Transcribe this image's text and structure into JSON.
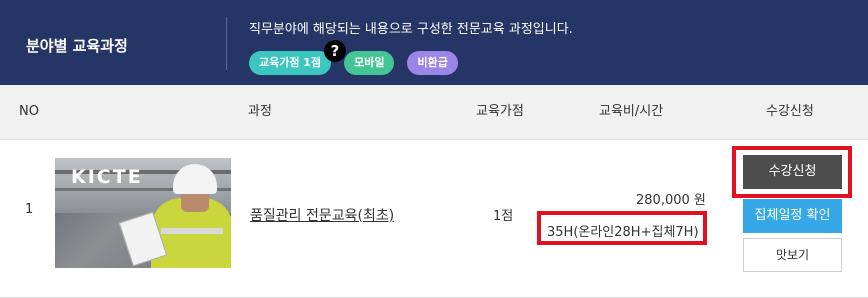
{
  "header": {
    "title": "분야별 교육과정",
    "description": "직무분야에 해당되는 내용으로 구성한 전문교육 과정입니다.",
    "badges": [
      "교육가점 1점",
      "모바일",
      "비환급"
    ],
    "help_icon": "?"
  },
  "table": {
    "columns": [
      "NO",
      "과정",
      "교육가점",
      "교육비/시간",
      "수강신청"
    ],
    "rows": [
      {
        "no": "1",
        "thumb_logo": "KICTE",
        "course": "품질관리 전문교육(최초)",
        "points": "1점",
        "fee": "280,000 원",
        "hours": "35H(온라인28H+집체7H)",
        "apply": "수강신청",
        "schedule": "집체일정 확인",
        "preview": "맛보기"
      }
    ]
  },
  "colors": {
    "header_bg": "#253566",
    "highlight_border": "#e01020",
    "apply_btn": "#4d4d4d",
    "schedule_btn": "#36a8e8"
  }
}
